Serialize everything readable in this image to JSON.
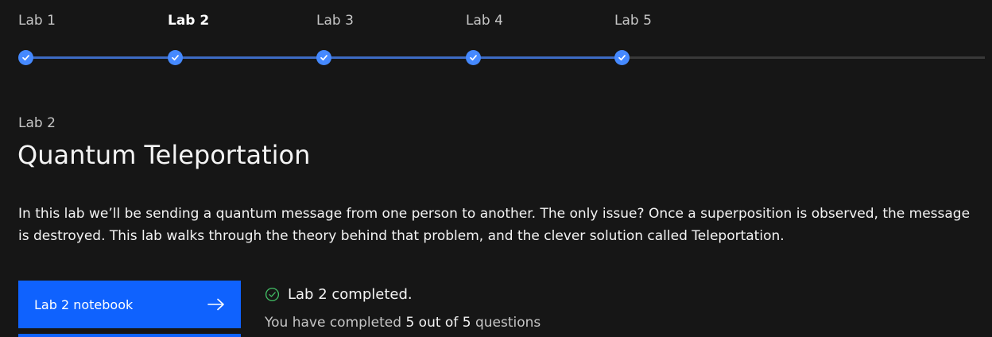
{
  "stepper": {
    "steps": [
      {
        "label": "Lab 1",
        "completed": true
      },
      {
        "label": "Lab 2",
        "completed": true,
        "current": true
      },
      {
        "label": "Lab 3",
        "completed": true
      },
      {
        "label": "Lab 4",
        "completed": true
      },
      {
        "label": "Lab 5",
        "completed": true
      }
    ],
    "icon": "checkmark-icon"
  },
  "lab": {
    "eyebrow": "Lab 2",
    "title": "Quantum Teleportation",
    "description": "In this lab we’ll be sending a quantum message from one person to another. The only issue? Once a superposition is observed, the message is destroyed. This lab walks through the theory behind that problem, and the clever solution called Teleportation."
  },
  "cta": {
    "label": "Lab 2 notebook",
    "icon": "arrow-right-icon"
  },
  "status": {
    "text": "Lab 2 completed.",
    "icon": "checkmark-outline-icon",
    "progress_prefix": "You have completed",
    "completed_count": "5",
    "out_of_text": "out of",
    "total_count": "5",
    "progress_suffix": "questions"
  },
  "colors": {
    "background": "#161616",
    "accent": "#0f62fe",
    "step_dot": "#4589ff",
    "success": "#42be65"
  }
}
